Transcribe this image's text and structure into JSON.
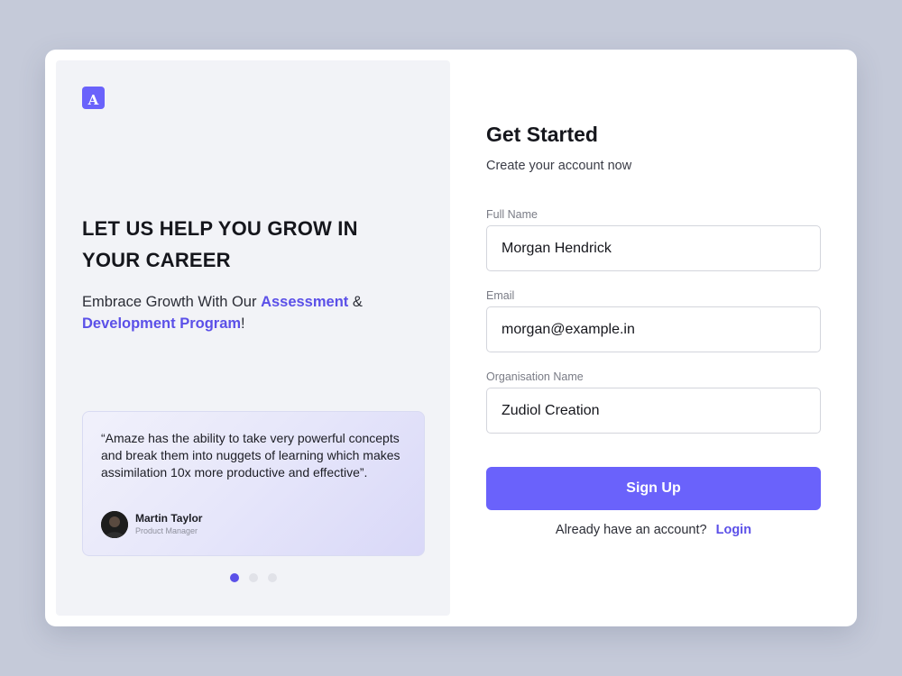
{
  "brand": {
    "logo_letter": "A",
    "logo_icon": "brand-logo-icon",
    "accent_color": "#6a62fb"
  },
  "hero": {
    "headline_line1": "LET US HELP YOU GROW IN",
    "headline_line2": "YOUR CAREER",
    "tagline_prefix": "Embrace Growth With Our ",
    "tagline_highlight1": "Assessment",
    "tagline_middle": " & ",
    "tagline_highlight2": "Development Program",
    "tagline_suffix": "!"
  },
  "testimonial": {
    "quote": "“Amaze has the ability to take very powerful concepts and break them into nuggets of learning which makes assimilation 10x more productive and effective”.",
    "author_name": "Martin Taylor",
    "author_role": "Product Manager"
  },
  "carousel": {
    "total": 3,
    "active_index": 0
  },
  "form": {
    "title": "Get Started",
    "subtitle": "Create your account now",
    "full_name": {
      "label": "Full Name",
      "value": "Morgan Hendrick"
    },
    "email": {
      "label": "Email",
      "value": "morgan@example.in"
    },
    "organisation": {
      "label": "Organisation Name",
      "value": "Zudiol Creation"
    },
    "submit_label": "Sign Up",
    "login_prompt": "Already have an account?",
    "login_label": "Login"
  }
}
